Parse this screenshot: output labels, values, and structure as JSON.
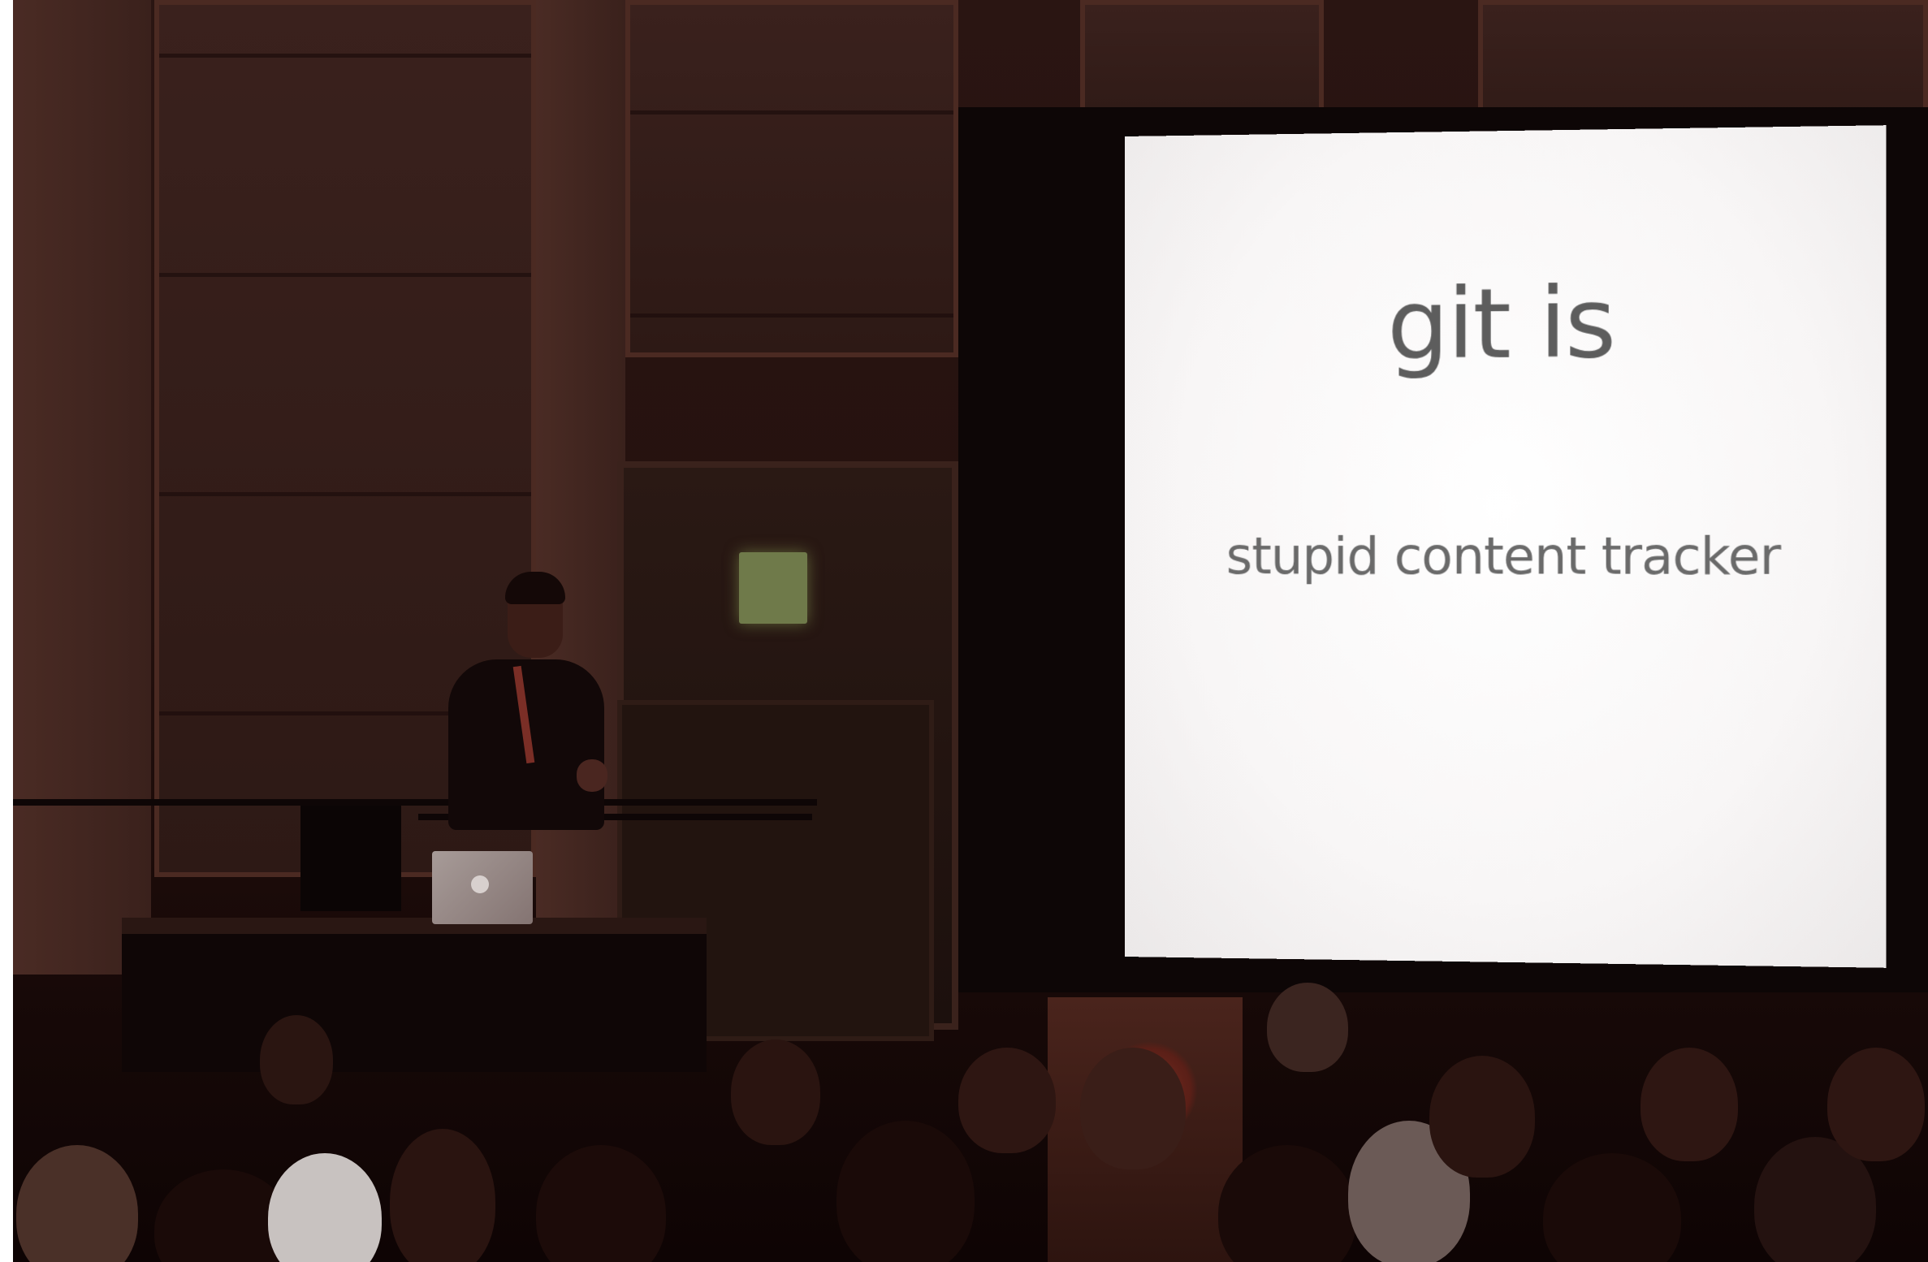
{
  "slide": {
    "title": "git is",
    "subtitle": "stupid content tracker"
  },
  "colors": {
    "room": "#26120f",
    "screen": "#ffffff",
    "slide_text": "#5d5d5d"
  }
}
